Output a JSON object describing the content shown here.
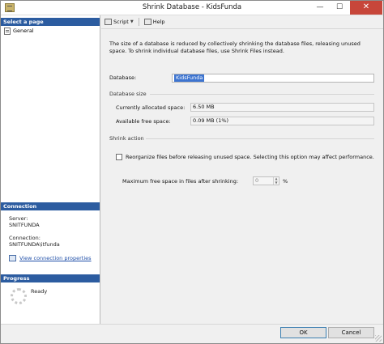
{
  "window": {
    "title": "Shrink Database - KidsFunda",
    "minimize_glyph": "—",
    "maximize_glyph": "☐",
    "close_glyph": "✕"
  },
  "left_pane": {
    "select_page_header": "Select a page",
    "pages": [
      {
        "label": "General",
        "icon": "page-icon"
      }
    ],
    "connection_header": "Connection",
    "server_label": "Server:",
    "server_value": "SNITFUNDA",
    "connection_label": "Connection:",
    "connection_value": "SNITFUNDA\\itfunda",
    "view_connection_link": "View connection properties",
    "progress_header": "Progress",
    "progress_status": "Ready"
  },
  "toolbar": {
    "script_label": "Script",
    "help_label": "Help"
  },
  "main": {
    "description": "The size of a database is reduced by collectively shrinking the database files, releasing unused space. To shrink individual database files, use Shrink Files instead.",
    "database_label": "Database:",
    "database_value": "KidsFunda",
    "database_size_header": "Database size",
    "currently_allocated_label": "Currently allocated space:",
    "currently_allocated_value": "6.50 MB",
    "available_free_label": "Available free space:",
    "available_free_value": "0.09 MB (1%)",
    "shrink_action_header": "Shrink action",
    "reorganize_label": "Reorganize files before releasing unused space.  Selecting this option may affect performance.",
    "reorganize_checked": false,
    "max_free_label": "Maximum free space in files after shrinking:",
    "max_free_value": "0",
    "max_free_unit": "%"
  },
  "buttons": {
    "ok_label": "OK",
    "cancel_label": "Cancel"
  },
  "colors": {
    "section_header": "#2c5ca0",
    "close_button": "#c7463a",
    "selection": "#3d74d0",
    "link": "#1f4fa8"
  }
}
